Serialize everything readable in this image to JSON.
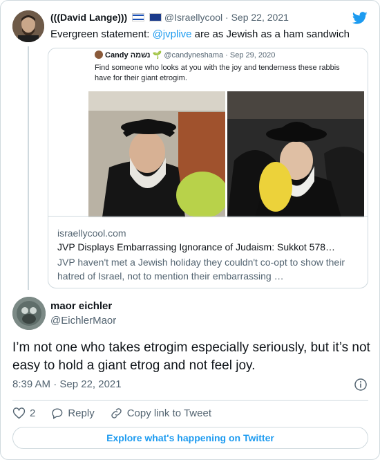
{
  "parent": {
    "name": "(((David Lange)))",
    "handle": "@Israellycool",
    "separator": "·",
    "date": "Sep 22, 2021",
    "text_before": "Evergreen statement: ",
    "mention": "@jvplive",
    "text_after": " are as Jewish as a ham sandwich"
  },
  "quoted": {
    "name": "Candy נשמה",
    "handle": "@candyneshama",
    "separator": "·",
    "date": "Sep 29, 2020",
    "text": "Find someone who looks at you with the joy and tenderness these rabbis have for their giant etrogim.",
    "link_domain": "israellycool.com",
    "link_title": "JVP Displays Embarrassing Ignorance of Judaism: Sukkot 578…",
    "link_description": "JVP haven't met a Jewish holiday they couldn't co-opt to show their hatred of Israel, not to mention their embarrassing …"
  },
  "main": {
    "name": "maor eichler",
    "handle": "@EichlerMaor",
    "text": "I’m not one who takes etrogim especially seriously, but it’s not easy to hold a giant etrog and not feel joy.",
    "time": "8:39 AM · Sep 22, 2021"
  },
  "actions": {
    "like_count": "2",
    "reply_label": "Reply",
    "copy_label": "Copy link to Tweet"
  },
  "explore_label": "Explore what's happening on Twitter",
  "colors": {
    "accent": "#1d9bf0",
    "muted": "#536471",
    "border": "#cfd9de"
  }
}
